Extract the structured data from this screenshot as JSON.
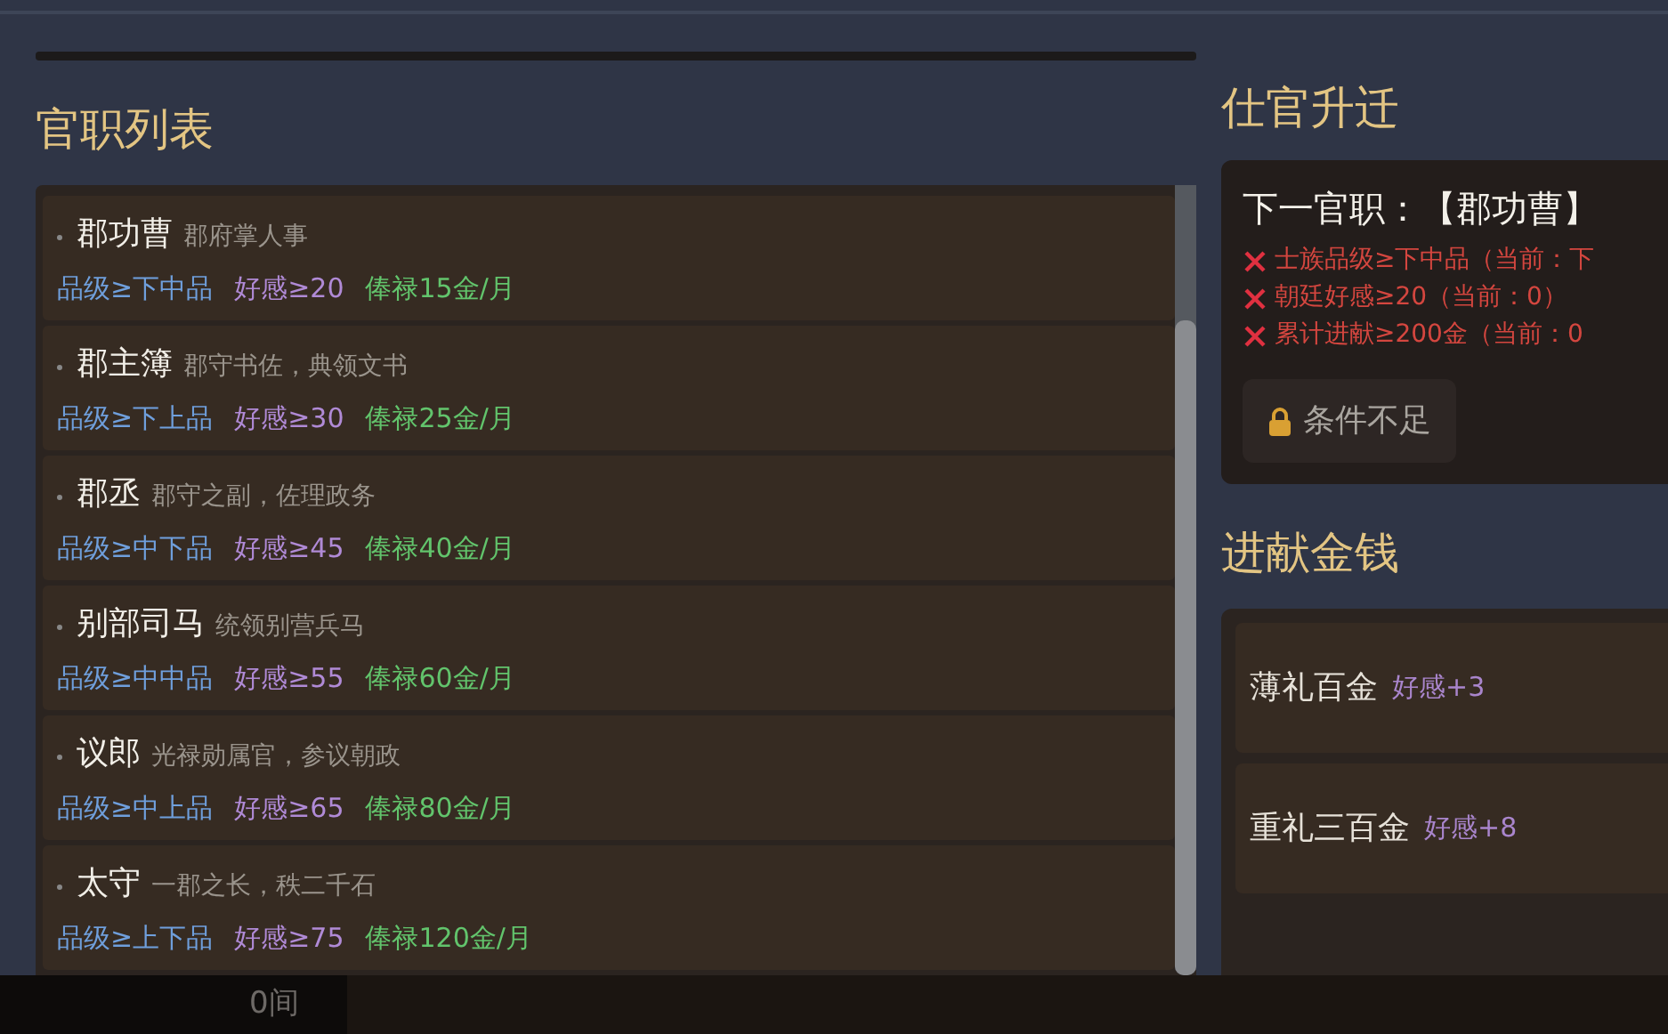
{
  "offices_panel": {
    "title": "官职列表",
    "items": [
      {
        "name": "郡功曹",
        "desc": "郡府掌人事",
        "rank": "品级≥下中品",
        "favor": "好感≥20",
        "salary": "俸禄15金/月"
      },
      {
        "name": "郡主簿",
        "desc": "郡守书佐，典领文书",
        "rank": "品级≥下上品",
        "favor": "好感≥30",
        "salary": "俸禄25金/月"
      },
      {
        "name": "郡丞",
        "desc": "郡守之副，佐理政务",
        "rank": "品级≥中下品",
        "favor": "好感≥45",
        "salary": "俸禄40金/月"
      },
      {
        "name": "别部司马",
        "desc": "统领别营兵马",
        "rank": "品级≥中中品",
        "favor": "好感≥55",
        "salary": "俸禄60金/月"
      },
      {
        "name": "议郎",
        "desc": "光禄勋属官，参议朝政",
        "rank": "品级≥中上品",
        "favor": "好感≥65",
        "salary": "俸禄80金/月"
      },
      {
        "name": "太守",
        "desc": "一郡之长，秩二千石",
        "rank": "品级≥上下品",
        "favor": "好感≥75",
        "salary": "俸禄120金/月"
      }
    ]
  },
  "promotion": {
    "title": "仕官升迁",
    "next_office": "下一官职：【郡功曹】",
    "conditions": [
      {
        "text": "士族品级≥下中品（当前：下",
        "met": false
      },
      {
        "text": "朝廷好感≥20（当前：0）",
        "met": false
      },
      {
        "text": "累计进献≥200金（当前：0",
        "met": false
      }
    ],
    "button": {
      "label": "条件不足",
      "disabled": true
    }
  },
  "donation": {
    "title": "进献金钱",
    "options": [
      {
        "label": "薄礼百金",
        "effect": "好感+3"
      },
      {
        "label": "重礼三百金",
        "effect": "好感+8"
      }
    ]
  },
  "bottom_bar": {
    "text": "0间"
  }
}
